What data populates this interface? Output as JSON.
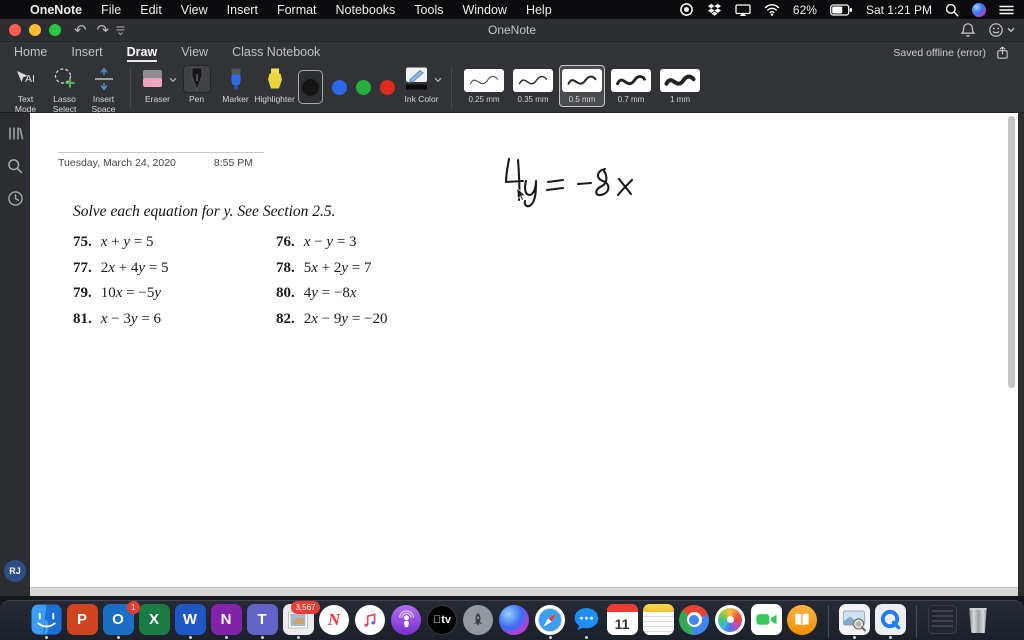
{
  "menubar": {
    "apple": "",
    "items": [
      "OneNote",
      "File",
      "Edit",
      "View",
      "Insert",
      "Format",
      "Notebooks",
      "Tools",
      "Window",
      "Help"
    ],
    "battery_percent": "62%",
    "clock": "Sat 1:21 PM"
  },
  "window": {
    "title": "OneNote",
    "tabs": [
      {
        "label": "Home",
        "active": false
      },
      {
        "label": "Insert",
        "active": false
      },
      {
        "label": "Draw",
        "active": true
      },
      {
        "label": "View",
        "active": false
      },
      {
        "label": "Class Notebook",
        "active": false
      }
    ],
    "save_status": "Saved offline (error)"
  },
  "toolbar": {
    "mode_tools": [
      {
        "name": "text-mode",
        "label": "Text Mode"
      },
      {
        "name": "lasso-select",
        "label": "Lasso Select"
      },
      {
        "name": "insert-space",
        "label": "Insert Space"
      }
    ],
    "draw_tools": [
      {
        "name": "eraser",
        "label": "Eraser",
        "dropdown": true,
        "selected": false
      },
      {
        "name": "pen",
        "label": "Pen",
        "dropdown": false,
        "selected": true
      },
      {
        "name": "marker",
        "label": "Marker",
        "dropdown": false,
        "selected": false
      },
      {
        "name": "highlighter",
        "label": "Highlighter",
        "dropdown": false,
        "selected": false
      }
    ],
    "ink_colors": [
      {
        "name": "black",
        "hex": "#141414",
        "selected": true
      },
      {
        "name": "blue",
        "hex": "#2d68e8",
        "selected": false
      },
      {
        "name": "green",
        "hex": "#23b03c",
        "selected": false
      },
      {
        "name": "red",
        "hex": "#e02b20",
        "selected": false
      }
    ],
    "ink_color_label": "Ink Color",
    "thicknesses": [
      {
        "label": "0.25 mm",
        "weight": 1,
        "selected": false
      },
      {
        "label": "0.35 mm",
        "weight": 1.5,
        "selected": false
      },
      {
        "label": "0.5 mm",
        "weight": 2.2,
        "selected": true
      },
      {
        "label": "0.7 mm",
        "weight": 3.2,
        "selected": false
      },
      {
        "label": "1 mm",
        "weight": 4.4,
        "selected": false
      }
    ]
  },
  "sidebar": {
    "icons": [
      "notebooks",
      "search",
      "recent"
    ],
    "avatar_initials": "RJ"
  },
  "page": {
    "date": "Tuesday, March 24, 2020",
    "time": "8:55 PM",
    "instruction": "Solve each equation for y. See Section 2.5.",
    "problems": [
      {
        "num": "75.",
        "eq": "x + y = 5"
      },
      {
        "num": "76.",
        "eq": "x − y = 3"
      },
      {
        "num": "77.",
        "eq": "2x + 4y = 5"
      },
      {
        "num": "78.",
        "eq": "5x + 2y = 7"
      },
      {
        "num": "79.",
        "eq": "10x = −5y"
      },
      {
        "num": "80.",
        "eq": "4y = −8x"
      },
      {
        "num": "81.",
        "eq": "x − 3y = 6"
      },
      {
        "num": "82.",
        "eq": "2x − 9y = −20"
      }
    ],
    "ink_annotation": "4y = −8x"
  },
  "dock": {
    "items": [
      {
        "name": "finder",
        "dot": true
      },
      {
        "name": "powerpoint",
        "letter": "P",
        "color": "#cf4520",
        "dot": false
      },
      {
        "name": "outlook",
        "letter": "O",
        "color": "#1a6fc4",
        "badge": "1",
        "dot": true
      },
      {
        "name": "excel",
        "letter": "X",
        "color": "#1a7c44",
        "dot": false
      },
      {
        "name": "word",
        "letter": "W",
        "color": "#1f58c4",
        "dot": true
      },
      {
        "name": "onenote",
        "letter": "N",
        "color": "#8023a8",
        "dot": true
      },
      {
        "name": "teams",
        "letter": "T",
        "color": "#6163c9",
        "dot": true
      },
      {
        "name": "mail",
        "badge": "3,567",
        "dot": true
      },
      {
        "name": "news",
        "dot": false
      },
      {
        "name": "music",
        "dot": false
      },
      {
        "name": "podcasts",
        "dot": false
      },
      {
        "name": "appletv",
        "glyph": "tv",
        "dot": false
      },
      {
        "name": "rocket",
        "dot": false
      },
      {
        "name": "siri",
        "dot": false
      },
      {
        "name": "safari",
        "dot": true
      },
      {
        "name": "messages",
        "dot": true
      },
      {
        "name": "calendar",
        "cal_day": "11",
        "dot": false
      },
      {
        "name": "notes",
        "dot": false
      },
      {
        "name": "chrome",
        "dot": false
      },
      {
        "name": "photos",
        "dot": false
      },
      {
        "name": "facetime",
        "dot": false
      },
      {
        "name": "books",
        "dot": false
      },
      {
        "name": "sep"
      },
      {
        "name": "preview",
        "dot": true
      },
      {
        "name": "quicktime",
        "dot": true
      },
      {
        "name": "sep"
      },
      {
        "name": "stack",
        "dot": false
      },
      {
        "name": "trash",
        "dot": false
      }
    ]
  }
}
